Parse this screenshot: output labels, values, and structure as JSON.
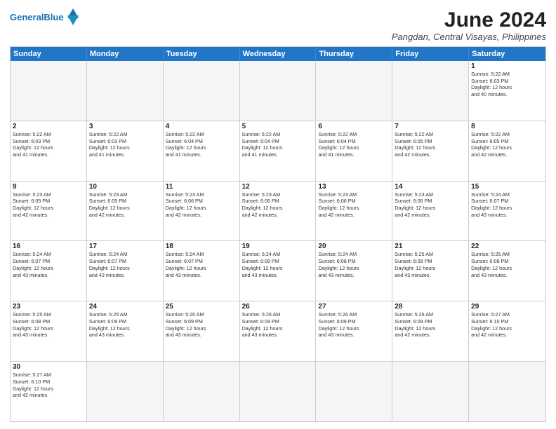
{
  "header": {
    "logo_general": "General",
    "logo_blue": "Blue",
    "month_title": "June 2024",
    "location": "Pangdan, Central Visayas, Philippines"
  },
  "calendar": {
    "days_of_week": [
      "Sunday",
      "Monday",
      "Tuesday",
      "Wednesday",
      "Thursday",
      "Friday",
      "Saturday"
    ],
    "rows": [
      [
        {
          "day": "",
          "info": "",
          "empty": true
        },
        {
          "day": "",
          "info": "",
          "empty": true
        },
        {
          "day": "",
          "info": "",
          "empty": true
        },
        {
          "day": "",
          "info": "",
          "empty": true
        },
        {
          "day": "",
          "info": "",
          "empty": true
        },
        {
          "day": "",
          "info": "",
          "empty": true
        },
        {
          "day": "1",
          "info": "Sunrise: 5:22 AM\nSunset: 6:03 PM\nDaylight: 12 hours\nand 40 minutes."
        }
      ],
      [
        {
          "day": "2",
          "info": "Sunrise: 5:22 AM\nSunset: 6:03 PM\nDaylight: 12 hours\nand 41 minutes."
        },
        {
          "day": "3",
          "info": "Sunrise: 5:22 AM\nSunset: 6:03 PM\nDaylight: 12 hours\nand 41 minutes."
        },
        {
          "day": "4",
          "info": "Sunrise: 5:22 AM\nSunset: 6:04 PM\nDaylight: 12 hours\nand 41 minutes."
        },
        {
          "day": "5",
          "info": "Sunrise: 5:22 AM\nSunset: 6:04 PM\nDaylight: 12 hours\nand 41 minutes."
        },
        {
          "day": "6",
          "info": "Sunrise: 5:22 AM\nSunset: 6:04 PM\nDaylight: 12 hours\nand 41 minutes."
        },
        {
          "day": "7",
          "info": "Sunrise: 5:22 AM\nSunset: 6:05 PM\nDaylight: 12 hours\nand 42 minutes."
        },
        {
          "day": "8",
          "info": "Sunrise: 5:22 AM\nSunset: 6:05 PM\nDaylight: 12 hours\nand 42 minutes."
        }
      ],
      [
        {
          "day": "9",
          "info": "Sunrise: 5:23 AM\nSunset: 6:05 PM\nDaylight: 12 hours\nand 42 minutes."
        },
        {
          "day": "10",
          "info": "Sunrise: 5:23 AM\nSunset: 6:05 PM\nDaylight: 12 hours\nand 42 minutes."
        },
        {
          "day": "11",
          "info": "Sunrise: 5:23 AM\nSunset: 6:06 PM\nDaylight: 12 hours\nand 42 minutes."
        },
        {
          "day": "12",
          "info": "Sunrise: 5:23 AM\nSunset: 6:06 PM\nDaylight: 12 hours\nand 42 minutes."
        },
        {
          "day": "13",
          "info": "Sunrise: 5:23 AM\nSunset: 6:06 PM\nDaylight: 12 hours\nand 42 minutes."
        },
        {
          "day": "14",
          "info": "Sunrise: 5:23 AM\nSunset: 6:06 PM\nDaylight: 12 hours\nand 42 minutes."
        },
        {
          "day": "15",
          "info": "Sunrise: 5:24 AM\nSunset: 6:07 PM\nDaylight: 12 hours\nand 43 minutes."
        }
      ],
      [
        {
          "day": "16",
          "info": "Sunrise: 5:24 AM\nSunset: 6:07 PM\nDaylight: 12 hours\nand 43 minutes."
        },
        {
          "day": "17",
          "info": "Sunrise: 5:24 AM\nSunset: 6:07 PM\nDaylight: 12 hours\nand 43 minutes."
        },
        {
          "day": "18",
          "info": "Sunrise: 5:24 AM\nSunset: 6:07 PM\nDaylight: 12 hours\nand 43 minutes."
        },
        {
          "day": "19",
          "info": "Sunrise: 5:24 AM\nSunset: 6:08 PM\nDaylight: 12 hours\nand 43 minutes."
        },
        {
          "day": "20",
          "info": "Sunrise: 5:24 AM\nSunset: 6:08 PM\nDaylight: 12 hours\nand 43 minutes."
        },
        {
          "day": "21",
          "info": "Sunrise: 5:25 AM\nSunset: 6:08 PM\nDaylight: 12 hours\nand 43 minutes."
        },
        {
          "day": "22",
          "info": "Sunrise: 5:25 AM\nSunset: 6:08 PM\nDaylight: 12 hours\nand 43 minutes."
        }
      ],
      [
        {
          "day": "23",
          "info": "Sunrise: 5:25 AM\nSunset: 6:08 PM\nDaylight: 12 hours\nand 43 minutes."
        },
        {
          "day": "24",
          "info": "Sunrise: 5:25 AM\nSunset: 6:09 PM\nDaylight: 12 hours\nand 43 minutes."
        },
        {
          "day": "25",
          "info": "Sunrise: 5:26 AM\nSunset: 6:09 PM\nDaylight: 12 hours\nand 43 minutes."
        },
        {
          "day": "26",
          "info": "Sunrise: 5:26 AM\nSunset: 6:09 PM\nDaylight: 12 hours\nand 43 minutes."
        },
        {
          "day": "27",
          "info": "Sunrise: 5:26 AM\nSunset: 6:09 PM\nDaylight: 12 hours\nand 43 minutes."
        },
        {
          "day": "28",
          "info": "Sunrise: 5:26 AM\nSunset: 6:09 PM\nDaylight: 12 hours\nand 42 minutes."
        },
        {
          "day": "29",
          "info": "Sunrise: 5:27 AM\nSunset: 6:10 PM\nDaylight: 12 hours\nand 42 minutes."
        }
      ],
      [
        {
          "day": "30",
          "info": "Sunrise: 5:27 AM\nSunset: 6:10 PM\nDaylight: 12 hours\nand 42 minutes."
        },
        {
          "day": "",
          "info": "",
          "empty": true
        },
        {
          "day": "",
          "info": "",
          "empty": true
        },
        {
          "day": "",
          "info": "",
          "empty": true
        },
        {
          "day": "",
          "info": "",
          "empty": true
        },
        {
          "day": "",
          "info": "",
          "empty": true
        },
        {
          "day": "",
          "info": "",
          "empty": true
        }
      ]
    ]
  }
}
